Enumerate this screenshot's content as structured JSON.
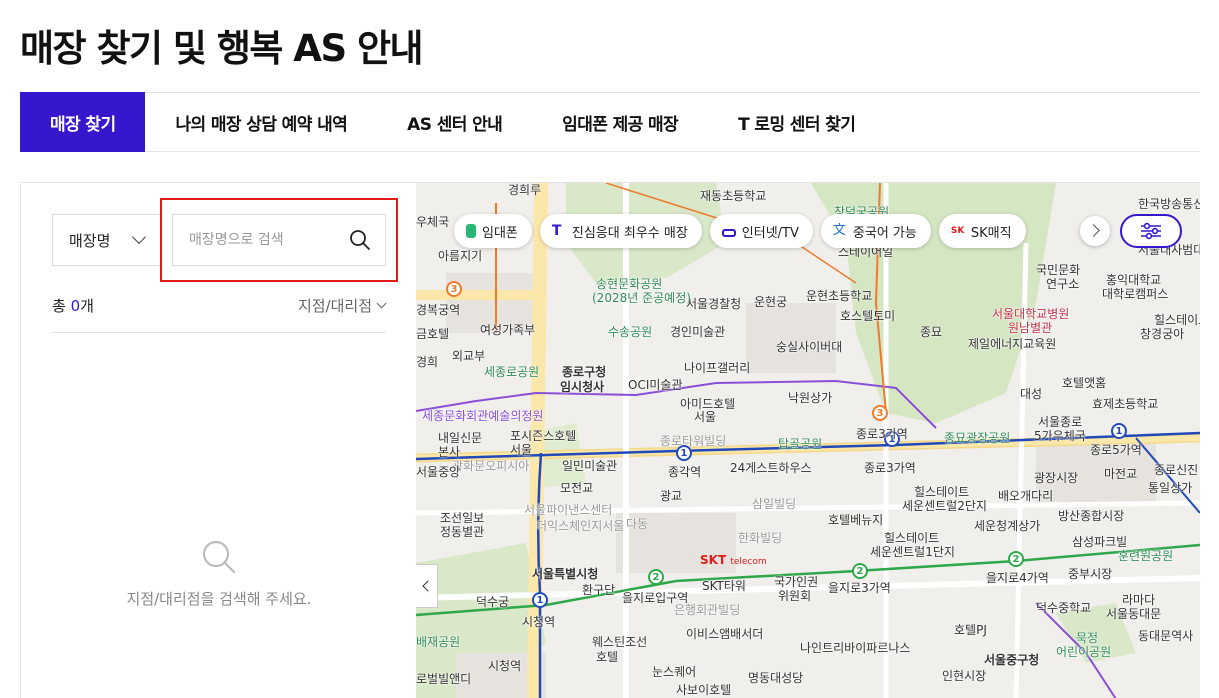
{
  "page": {
    "title": "매장 찾기 및 행복 AS 안내"
  },
  "tabs": [
    {
      "label": "매장 찾기",
      "active": true
    },
    {
      "label": "나의 매장 상담 예약 내역",
      "active": false
    },
    {
      "label": "AS 센터 안내",
      "active": false
    },
    {
      "label": "임대폰 제공 매장",
      "active": false
    },
    {
      "label": "T 로밍 센터 찾기",
      "active": false
    }
  ],
  "search": {
    "dropdown_value": "매장명",
    "placeholder": "매장명으로 검색",
    "value": ""
  },
  "results": {
    "count_prefix": "총 ",
    "count": "0",
    "count_suffix": "개",
    "sort_label": "지점/대리점",
    "empty_message": "지점/대리점을 검색해 주세요."
  },
  "map_filters": [
    {
      "label": "임대폰",
      "icon": "phone-icon",
      "color": "#2bb673"
    },
    {
      "label": "진심응대 최우수 매장",
      "icon": "t-logo-icon",
      "color": "#3617ce"
    },
    {
      "label": "인터넷/TV",
      "icon": "router-icon",
      "color": "#3617ce"
    },
    {
      "label": "중국어 가능",
      "icon": "chinese-char-icon",
      "color": "#1a6fd6"
    },
    {
      "label": "SK매직",
      "icon": "sk-logo-icon",
      "color": "#e21b1b"
    }
  ],
  "map_labels": {
    "l1": "경희루",
    "l2": "재동초등학교",
    "l3": "창덕궁공원",
    "l4": "한국방송통신",
    "l5": "우체국",
    "l6": "스테이어일",
    "l7": "아름지기",
    "l8": "송현문화공원",
    "l9": "(2028년 준공예정)",
    "l10": "서울경찰청",
    "l11": "운현궁",
    "l12": "운현초등학교",
    "l13": "국민문화",
    "l14": "연구소",
    "l15": "경복궁역",
    "l16": "여성가족부",
    "l17": "수송공원",
    "l18": "경인미술관",
    "l19": "호스텔토미",
    "l20": "종묘",
    "l21": "서울대학교병원",
    "l22": "원남별관",
    "l23": "외교부",
    "l24": "숭실사이버대",
    "l25": "제일에너지교육원",
    "l26": "세종로공원",
    "l27": "종로구청",
    "l28": "임시청사",
    "l29": "나이프갤러리",
    "l30": "OCI미술관",
    "l31": "호텔앳홈",
    "l32": "세종문화회관예술의정원",
    "l33": "아미드호텔",
    "l34": "서울",
    "l35": "낙원상가",
    "l36": "대성",
    "l37": "효제초등학교",
    "l38": "내일신문",
    "l39": "본사",
    "l40": "포시즌스호텔",
    "l41": "서울",
    "l42": "종로타워빌딩",
    "l43": "탑골공원",
    "l44": "종로3가역",
    "l45": "종묘광장공원",
    "l46": "서울종로",
    "l47": "5가우체국",
    "l48": "종로5가역",
    "l49": "일민미술관",
    "l50": "종각역",
    "l51": "24게스트하우스",
    "l52": "종로3가역",
    "l53": "광장시장",
    "l54": "마전교",
    "l55": "종로신진",
    "l56": "광화문오피시아",
    "l57": "모전교",
    "l58": "광교",
    "l59": "삼일빌딩",
    "l60": "힐스테이트",
    "l61": "세운센트럴2단지",
    "l62": "배오개다리",
    "l63": "통일상가",
    "l64": "조선일보",
    "l65": "정동별관",
    "l66": "서울파이낸스센터",
    "l67": "더익스체인지서울",
    "l68": "다동",
    "l69": "호텔베뉴지",
    "l70": "세운청계상가",
    "l71": "방산종합시장",
    "l72": "한화빌딩",
    "l73": "힐스테이트",
    "l74": "세운센트럴1단지",
    "l75": "삼성파크빌",
    "l76": "훈련원공원",
    "l77": "서울특별시청",
    "l78": "SKT타워",
    "l79": "국가인권",
    "l80": "위원회",
    "l81": "을지로3가역",
    "l82": "을지로4가역",
    "l83": "중부시장",
    "l84": "덕수궁",
    "l85": "환구단",
    "l86": "을지로입구역",
    "l87": "은행회관빌딩",
    "l88": "라마다",
    "l89": "시청역",
    "l90": "덕수중학교",
    "l91": "서울동대문",
    "l92": "배재공원",
    "l93": "웨스틴조선",
    "l94": "호텔",
    "l95": "이비스앰배서더",
    "l96": "나인트리바이파르나스",
    "l97": "호텔PJ",
    "l98": "묵정",
    "l99": "어린이공원",
    "l100": "동대문역사",
    "l101": "시청역",
    "l102": "눈스퀘어",
    "l103": "명동대성당",
    "l104": "서울중구청",
    "l105": "인현시장",
    "l106": "로벌빌앤디",
    "l107": "사보이호텔",
    "l108": "경희",
    "l109": "홍익대학교",
    "l110": "대학로캠퍼스",
    "l111": "서울대사범대학",
    "l112": "힐스테이트",
    "l113": "창경궁아",
    "l114": "금호텔",
    "l115": "서울중앙",
    "l116": "SKT",
    "l117": "telecom"
  }
}
